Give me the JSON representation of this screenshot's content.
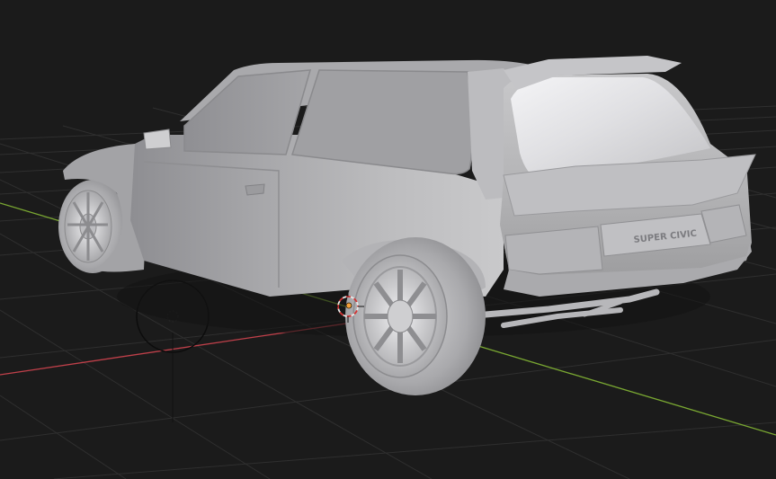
{
  "viewport": {
    "background": "#1b1b1b",
    "grid_color": "#2f2f2f",
    "axis_x_color": "#c0404a",
    "axis_y_color": "#7aa832"
  },
  "model": {
    "badge_text": "SUPER CIVIC",
    "body_color": "#b9b9bb"
  },
  "icons": {
    "origin": "origin-marker-icon",
    "cursor": "3d-cursor-icon",
    "camera": "camera-gizmo-icon"
  }
}
